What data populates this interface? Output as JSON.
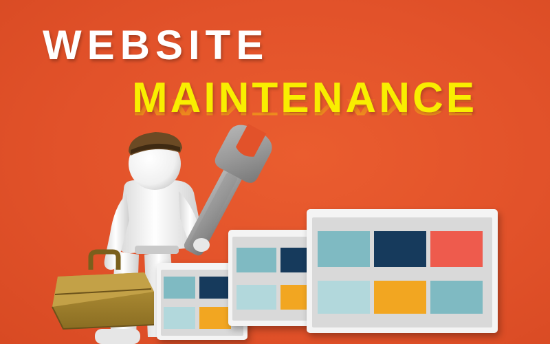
{
  "headline": {
    "line1": "WEBSITE",
    "line2": "MAINTENANCE"
  },
  "colors": {
    "background": "#e2522a",
    "line1_text": "#ffffff",
    "line2_text": "#f9ee00",
    "tile_teal": "#7fbac2",
    "tile_navy": "#163a5c",
    "tile_red": "#ee5b4d",
    "tile_light": "#b2d8dc",
    "tile_gold": "#f2a621",
    "toolbox": "#a0812b",
    "helmet": "#6b4a24"
  },
  "illustration": {
    "figure": "white-3d-person-icon",
    "tool": "wrench-icon",
    "case": "toolbox-icon",
    "screens": [
      "website-layout-panel",
      "website-layout-panel",
      "website-layout-panel"
    ]
  }
}
